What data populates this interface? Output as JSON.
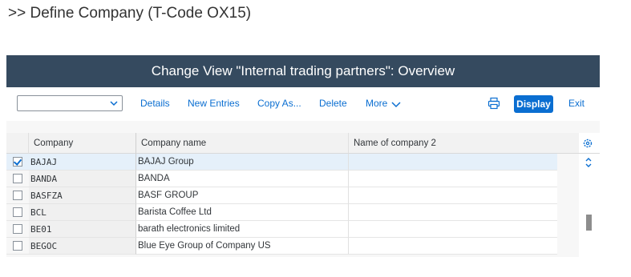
{
  "page": {
    "heading": ">> Define Company (T-Code OX15)"
  },
  "window": {
    "title": "Change View \"Internal trading partners\": Overview"
  },
  "toolbar": {
    "select_value": "",
    "details_label": "Details",
    "new_entries_label": "New Entries",
    "copy_as_label": "Copy As...",
    "delete_label": "Delete",
    "more_label": "More",
    "display_label": "Display",
    "exit_label": "Exit"
  },
  "table": {
    "columns": [
      "Company",
      "Company name",
      "Name of company 2"
    ],
    "rows": [
      {
        "selected": true,
        "company": "BAJAJ",
        "name": "BAJAJ Group",
        "name2": ""
      },
      {
        "selected": false,
        "company": "BANDA",
        "name": "BANDA",
        "name2": ""
      },
      {
        "selected": false,
        "company": "BASFZA",
        "name": "BASF GROUP",
        "name2": ""
      },
      {
        "selected": false,
        "company": "BCL",
        "name": "Barista Coffee Ltd",
        "name2": ""
      },
      {
        "selected": false,
        "company": "BE01",
        "name": "barath electronics limited",
        "name2": ""
      },
      {
        "selected": false,
        "company": "BEGOC",
        "name": "Blue Eye Group of Company US",
        "name2": ""
      }
    ]
  },
  "colors": {
    "title_bar": "#354a5f",
    "accent": "#0a6ed1",
    "selected_row": "#e5f0fa"
  },
  "icons": [
    "chevron-down-icon",
    "print-icon",
    "settings-icon",
    "scroll-up-down-icon",
    "checkbox-icon"
  ]
}
